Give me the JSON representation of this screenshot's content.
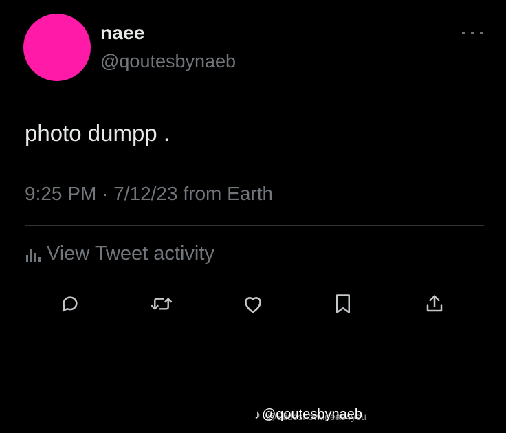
{
  "user": {
    "display_name": "naee",
    "handle": "@qoutesbynaeb",
    "avatar_color": "#ff1aa8"
  },
  "more_icon": "more-horizontal-icon",
  "tweet": {
    "text": "photo dumpp .",
    "meta": "9:25 PM · 7/12/23 from Earth"
  },
  "activity": {
    "icon": "bar-chart-icon",
    "label": "View Tweet activity"
  },
  "actions": [
    {
      "name": "reply",
      "icon": "reply-icon"
    },
    {
      "name": "retweet",
      "icon": "retweet-icon"
    },
    {
      "name": "like",
      "icon": "heart-icon"
    },
    {
      "name": "bookmark",
      "icon": "bookmark-icon"
    },
    {
      "name": "share",
      "icon": "share-icon"
    }
  ],
  "watermark": {
    "icon": "tiktok-icon",
    "text": "@qoutesbynaeb",
    "overlay_text": "@Slideshow.ideas4you"
  },
  "colors": {
    "background": "#000000",
    "primary_text": "#e7e9ea",
    "secondary_text": "#71767b",
    "divider": "#2f3336"
  }
}
